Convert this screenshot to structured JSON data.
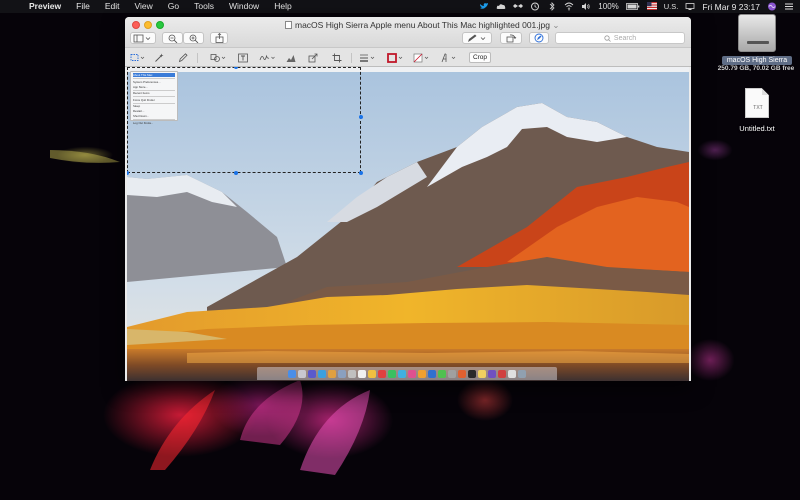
{
  "menubar": {
    "apple_glyph": "",
    "items": [
      {
        "label": "Preview",
        "bold": true
      },
      {
        "label": "File"
      },
      {
        "label": "Edit"
      },
      {
        "label": "View"
      },
      {
        "label": "Go"
      },
      {
        "label": "Tools"
      },
      {
        "label": "Window"
      },
      {
        "label": "Help"
      }
    ],
    "battery": "100%",
    "flag": "U.S.",
    "datetime": "Fri Mar 9  23:17"
  },
  "window": {
    "title": "macOS High Sierra Apple menu About This Mac highlighted 001.jpg",
    "title_chevron": "⌄",
    "search_placeholder": "Search",
    "crop_label": "Crop"
  },
  "screenshot_menu": {
    "items": [
      "About This Mac",
      "System Preferences...",
      "App Store...",
      "Recent Items",
      "Force Quit Finder",
      "Sleep",
      "Restart...",
      "Shut Down...",
      "Log Out Kinda..."
    ]
  },
  "desktop": {
    "drive_label": "macOS High Sierra",
    "drive_sub": "250.79 GB, 70.02 GB free",
    "txt_ext": "TXT",
    "txt_label": "Untitled.txt"
  },
  "colors": {
    "selection_handle": "#1a73e8",
    "menu_highlight": "#3b7cd8",
    "close": "#fc5f57",
    "minimize": "#fdbc2e",
    "maximize": "#28c840"
  }
}
